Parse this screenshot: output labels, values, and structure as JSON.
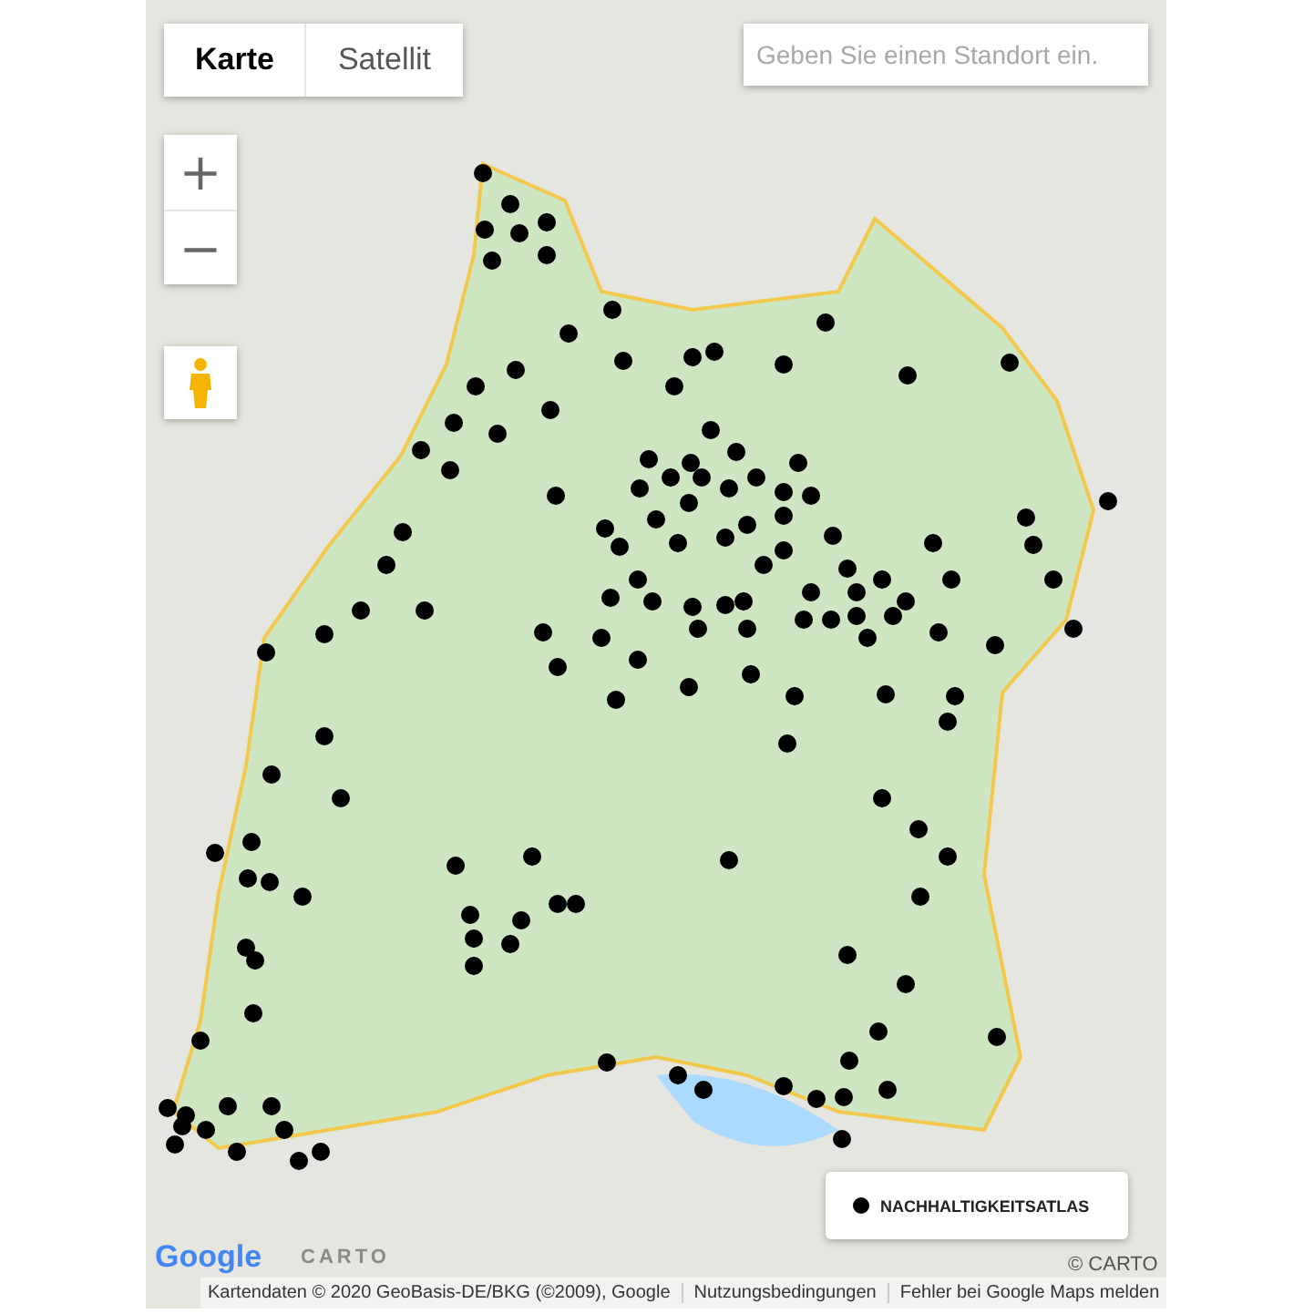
{
  "map_type_tabs": [
    {
      "label": "Karte",
      "selected": true
    },
    {
      "label": "Satellit",
      "selected": false
    }
  ],
  "search": {
    "placeholder": "Geben Sie einen Standort ein."
  },
  "zoom_controls": [
    "+",
    "−"
  ],
  "legend": {
    "label": "NACHHALTIGKEITSATLAS",
    "color": "#000000"
  },
  "logos": [
    "Google",
    "CARTO"
  ],
  "carto_credit": "© CARTO",
  "footer": [
    "Kartendaten © 2020 GeoBasis-DE/BKG (©2009), Google",
    "Nutzungsbedingungen",
    "Fehler bei Google Maps melden"
  ]
}
